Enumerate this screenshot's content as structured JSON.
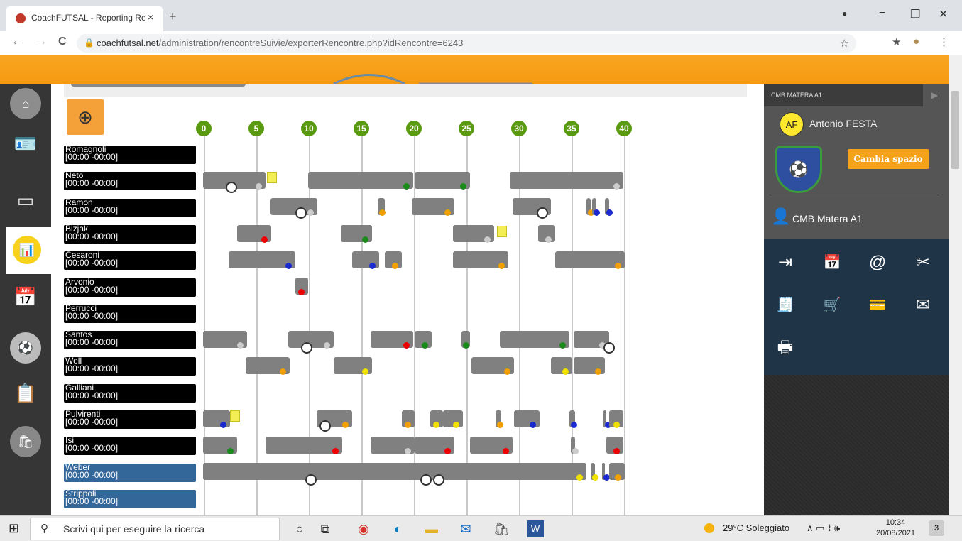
{
  "browser": {
    "tab_title": "CoachFUTSAL - Reporting Renco",
    "tab_close": "×",
    "new_tab": "+",
    "url_host": "coachfutsal.net",
    "url_path": "/administration/rencontreSuivie/exporterRencontre.php?idRencontre=6243",
    "back_icon": "←",
    "forward_icon": "→",
    "reload_icon": "C",
    "lock_icon": "🔒",
    "star_icon": "☆",
    "ext_icon": "★",
    "profile_icon": "●",
    "menu_icon": "⋮",
    "win_minimize": "−",
    "win_restore": "❐",
    "win_close": "✕",
    "win_record": "●"
  },
  "timeline": {
    "markers": [
      "0",
      "5",
      "10",
      "15",
      "20",
      "25",
      "30",
      "35",
      "40"
    ],
    "zoom_icon": "⊕",
    "players": [
      {
        "name": "Romagnoli",
        "time": "[00:00 -00:00]",
        "sub": false
      },
      {
        "name": "Neto",
        "time": "[00:00 -00:00]",
        "sub": false
      },
      {
        "name": "Ramon",
        "time": "[00:00 -00:00]",
        "sub": false
      },
      {
        "name": "Bizjak",
        "time": "[00:00 -00:00]",
        "sub": false
      },
      {
        "name": "Cesaroni",
        "time": "[00:00 -00:00]",
        "sub": false
      },
      {
        "name": "Arvonio",
        "time": "[00:00 -00:00]",
        "sub": false
      },
      {
        "name": "Perrucci",
        "time": "[00:00 -00:00]",
        "sub": false
      },
      {
        "name": "Santos",
        "time": "[00:00 -00:00]",
        "sub": false
      },
      {
        "name": "Well",
        "time": "[00:00 -00:00]",
        "sub": false
      },
      {
        "name": "Galliani",
        "time": "[00:00 -00:00]",
        "sub": false
      },
      {
        "name": "Pulvirenti",
        "time": "[00:00 -00:00]",
        "sub": false
      },
      {
        "name": "Isi",
        "time": "[00:00 -00:00]",
        "sub": false
      },
      {
        "name": "Weber",
        "time": "[00:00 -00:00]",
        "sub": true
      },
      {
        "name": "Strippoli",
        "time": "[00:00 -00:00]",
        "sub": true
      }
    ]
  },
  "right_panel": {
    "header": "CMB MATERA A1",
    "header_arrow": "▶|",
    "user_initials": "AF",
    "user_name": "Antonio FESTA",
    "crest_icon": "⚽",
    "switch_button": "Cambia spazio",
    "person_icon": "👤",
    "team_name": "CMB Matera A1",
    "icons": [
      "⇥",
      "📅",
      "@",
      "✂",
      "🧾",
      "🛒",
      "💳",
      "✉",
      "🖶"
    ]
  },
  "taskbar": {
    "start_icon": "⊞",
    "search_icon": "⚲",
    "search_placeholder": "Scrivi qui per eseguire la ricerca",
    "weather": "29°C  Soleggiato",
    "time": "10:34",
    "date": "20/08/2021",
    "apps": [
      "○",
      "⧉",
      "◉",
      "◐",
      "▬",
      "✉",
      "🛍",
      "W"
    ],
    "tray": "∧ ▭ ⌇ 🕪",
    "notify": "3"
  },
  "nav_icons": [
    "⌂",
    "🪪",
    "▭",
    "📊",
    "📅",
    "⚽",
    "📋",
    "🛍"
  ],
  "colors": {
    "accent_orange": "#f59a10",
    "marker_green": "#5a9a10",
    "sub_blue": "#336699",
    "panel_dark": "#1f3447"
  }
}
